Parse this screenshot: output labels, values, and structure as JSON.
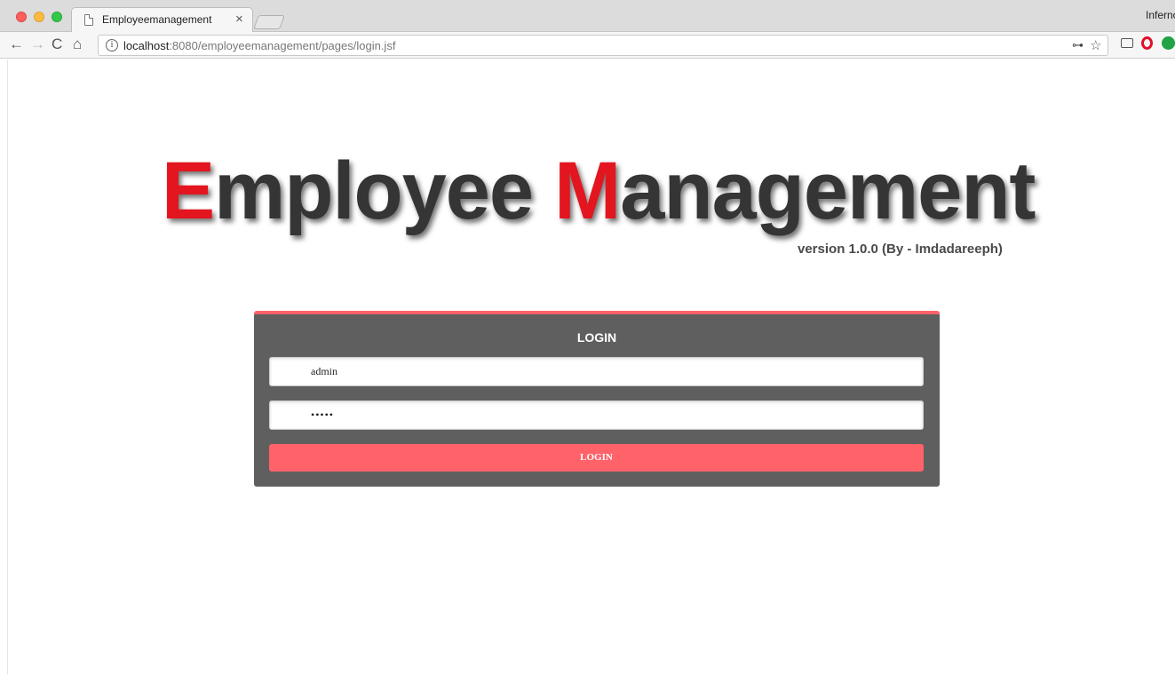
{
  "browser": {
    "tab_title": "Employeemanagement",
    "tab_close": "×",
    "profile_name": "Inferno",
    "url_host": "localhost",
    "url_rest": ":8080/employeemanagement/pages/login.jsf",
    "back_glyph": "←",
    "forward_glyph": "→",
    "reload_glyph": "C",
    "home_glyph": "⌂",
    "info_glyph": "i",
    "key_glyph": "⊶",
    "star_glyph": "☆"
  },
  "brand": {
    "word1_initial": "E",
    "word1_rest": "mployee ",
    "word2_initial": "M",
    "word2_rest": "anagement",
    "version": "version 1.0.0 (By - Imdadareeph)",
    "accent_color": "#e3151f"
  },
  "login": {
    "heading": "LOGIN",
    "username_value": "admin",
    "password_value": "•••••",
    "button_label": "LOGIN",
    "accent_color": "#ff6269",
    "card_color": "#5f5f5f"
  }
}
